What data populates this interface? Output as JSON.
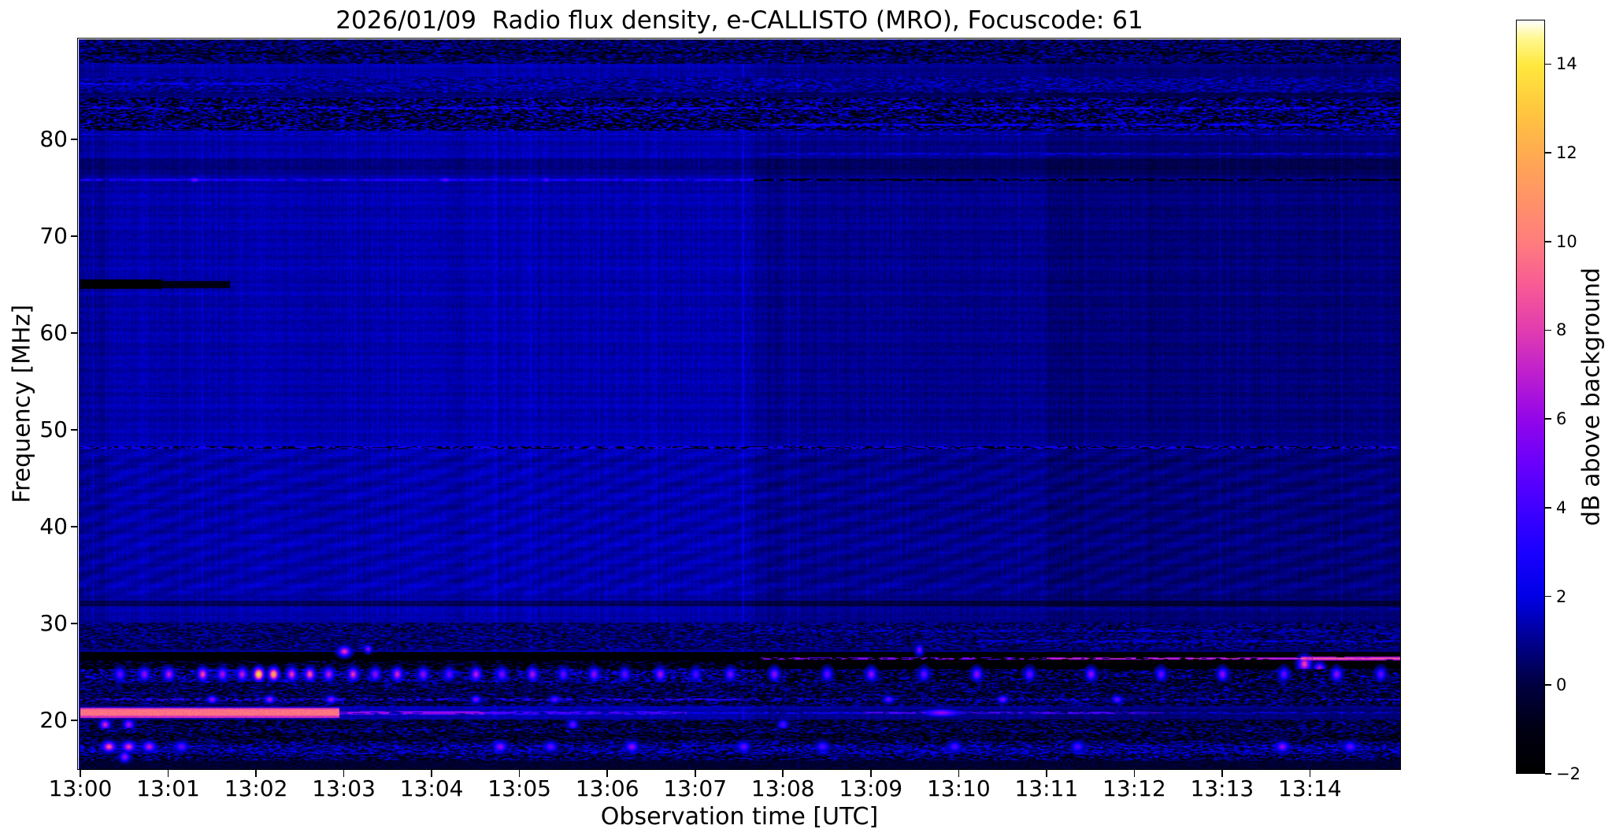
{
  "title": "2026/01/09  Radio flux density, e-CALLISTO (MRO), Focuscode: 61",
  "axes": {
    "x_label": "Observation time [UTC]",
    "y_label": "Frequency [MHz]",
    "x_ticks": [
      "13:00",
      "13:01",
      "13:02",
      "13:03",
      "13:04",
      "13:05",
      "13:06",
      "13:07",
      "13:08",
      "13:09",
      "13:10",
      "13:11",
      "13:12",
      "13:13",
      "13:14"
    ],
    "y_ticks": [
      80,
      70,
      60,
      50,
      40,
      30,
      20
    ],
    "colorbar_label": "dB above background",
    "colorbar_ticks": [
      {
        "v": 14,
        "label": "14"
      },
      {
        "v": 12,
        "label": "12"
      },
      {
        "v": 10,
        "label": "10"
      },
      {
        "v": 8,
        "label": "8"
      },
      {
        "v": 6,
        "label": "6"
      },
      {
        "v": 4,
        "label": "4"
      },
      {
        "v": 2,
        "label": "2"
      },
      {
        "v": 0,
        "label": "0"
      },
      {
        "v": -2,
        "label": "−2"
      }
    ]
  },
  "chart_data": {
    "type": "heatmap",
    "title": "2026/01/09  Radio flux density, e-CALLISTO (MRO), Focuscode: 61",
    "xlabel": "Observation time [UTC]",
    "ylabel": "Frequency [MHz]",
    "date": "2026/01/09",
    "instrument": "e-CALLISTO (MRO)",
    "focuscode": "61",
    "x_start": "13:00",
    "x_duration_minutes": 15.05,
    "y_range_mhz": [
      14.98,
      90.32
    ],
    "value_range_db": [
      -2,
      15
    ],
    "colormap_stops": [
      {
        "x": 0.0,
        "c": "#000000"
      },
      {
        "x": 0.059,
        "c": "#000014"
      },
      {
        "x": 0.118,
        "c": "#000041"
      },
      {
        "x": 0.176,
        "c": "#00008f"
      },
      {
        "x": 0.235,
        "c": "#0000e6"
      },
      {
        "x": 0.294,
        "c": "#1a00ff"
      },
      {
        "x": 0.353,
        "c": "#4000ff"
      },
      {
        "x": 0.412,
        "c": "#6a00fc"
      },
      {
        "x": 0.471,
        "c": "#9406e8"
      },
      {
        "x": 0.529,
        "c": "#bc1ecf"
      },
      {
        "x": 0.588,
        "c": "#e13cb0"
      },
      {
        "x": 0.647,
        "c": "#f75a95"
      },
      {
        "x": 0.706,
        "c": "#ff7d7d"
      },
      {
        "x": 0.765,
        "c": "#ff9466"
      },
      {
        "x": 0.824,
        "c": "#ffab50"
      },
      {
        "x": 0.882,
        "c": "#ffc73e"
      },
      {
        "x": 0.941,
        "c": "#ffe83e"
      },
      {
        "x": 0.976,
        "c": "#fff78f"
      },
      {
        "x": 1.0,
        "c": "#ffffff"
      }
    ],
    "background_regions": [
      {
        "t1": 0,
        "t2": 0.32,
        "level": 1.05
      },
      {
        "t1": 0.32,
        "t2": 7.67,
        "level": 1.35
      },
      {
        "t1": 7.67,
        "t2": 11.0,
        "level": 0.95
      },
      {
        "t1": 11.0,
        "t2": 15.05,
        "level": 0.7
      }
    ],
    "fringe_band_mhz": [
      33.0,
      48.0
    ],
    "features": [
      {
        "kind": "speckle",
        "f1": 87.9,
        "f2": 90.3,
        "t1": 0,
        "t2": 15.05,
        "p": 0.45,
        "bright": [
          0.6,
          1.8
        ],
        "dark": [
          -1.3,
          0.1
        ]
      },
      {
        "kind": "dash",
        "f": 88.9,
        "hw": 1,
        "t1": 0,
        "t2": 15.05,
        "amp": -1.6,
        "duty": 0.5,
        "dash": [
          3,
          9
        ]
      },
      {
        "kind": "speckle",
        "f1": 84.9,
        "f2": 86.4,
        "t1": 0,
        "t2": 15.05,
        "p": 0.5,
        "bright": [
          1.0,
          2.2
        ],
        "dark": [
          0.0,
          0.8
        ]
      },
      {
        "kind": "dash",
        "f": 85.8,
        "hw": 1,
        "t1": 0,
        "t2": 2.3,
        "amp": 2.6,
        "duty": 0.75,
        "dash": [
          4,
          14
        ]
      },
      {
        "kind": "speckle",
        "f1": 81.0,
        "f2": 84.3,
        "t1": 0,
        "t2": 15.05,
        "p": 0.42,
        "bright": [
          0.8,
          2.6
        ],
        "dark": [
          -1.9,
          -0.3
        ]
      },
      {
        "kind": "dash",
        "f": 83.25,
        "hw": 1,
        "t1": 0,
        "t2": 15.05,
        "amp": 2.9,
        "duty": 0.55,
        "dash": [
          3,
          10
        ]
      },
      {
        "kind": "dash",
        "f": 81.55,
        "hw": 1,
        "t1": 7.67,
        "t2": 15.05,
        "amp": 2.7,
        "duty": 0.7,
        "dash": [
          4,
          12
        ]
      },
      {
        "kind": "dash",
        "f": 80.55,
        "hw": 1,
        "t1": 0,
        "t2": 15.05,
        "amp": 2.2,
        "duty": 0.45,
        "dash": [
          3,
          9
        ]
      },
      {
        "kind": "dash",
        "f": 78.55,
        "hw": 1,
        "t1": 7.67,
        "t2": 15.05,
        "amp": 2.3,
        "duty": 0.55,
        "dash": [
          3,
          10
        ]
      },
      {
        "kind": "add",
        "f1": 76.4,
        "f2": 78.0,
        "t1": 0,
        "t2": 15.05,
        "amp": -0.5
      },
      {
        "kind": "add",
        "f1": 84.3,
        "f2": 84.9,
        "t1": 0,
        "t2": 15.05,
        "amp": -0.45
      },
      {
        "kind": "dash",
        "f": 75.85,
        "hw": 1,
        "t1": 0,
        "t2": 7.67,
        "amp": 3.4,
        "duty": 0.8,
        "dash": [
          4,
          12
        ]
      },
      {
        "kind": "blob",
        "t": 1.3,
        "f": 75.85,
        "amp": 5.5,
        "rx": 5,
        "ry": 2
      },
      {
        "kind": "blob",
        "t": 4.15,
        "f": 75.85,
        "amp": 5.0,
        "rx": 6,
        "ry": 2
      },
      {
        "kind": "blob",
        "t": 5.3,
        "f": 75.85,
        "amp": 4.6,
        "rx": 4,
        "ry": 2
      },
      {
        "kind": "dash",
        "f": 75.85,
        "hw": 1,
        "t1": 7.67,
        "t2": 15.05,
        "amp": -1.8,
        "duty": 0.85,
        "dash": [
          4,
          12
        ]
      },
      {
        "kind": "dash",
        "f": 75.85,
        "hw": 1,
        "t1": 7.67,
        "t2": 15.05,
        "amp": 2.6,
        "duty": 0.1,
        "dash": [
          2,
          5
        ]
      },
      {
        "kind": "set",
        "f1": 64.6,
        "f2": 65.5,
        "t1": 0,
        "t2": 0.93,
        "amp": -1.95,
        "noise": 0.1
      },
      {
        "kind": "set",
        "f1": 64.75,
        "f2": 65.35,
        "t1": 0.93,
        "t2": 1.7,
        "amp": -1.1,
        "noise": 0.3
      },
      {
        "kind": "dash2",
        "f": 48.2,
        "hw": 1,
        "t1": 0,
        "t2": 15.05,
        "bright": 2.7,
        "dark": -1.9,
        "dash": [
          2,
          7
        ]
      },
      {
        "kind": "add",
        "f1": 48.45,
        "f2": 48.8,
        "t1": 0,
        "t2": 15.05,
        "amp": 0.3
      },
      {
        "kind": "add",
        "f1": 31.9,
        "f2": 32.35,
        "t1": 0,
        "t2": 15.05,
        "amp": -1.0
      },
      {
        "kind": "dash",
        "f": 31.55,
        "hw": 1,
        "t1": 10.4,
        "t2": 15.05,
        "amp": 1.5,
        "duty": 0.5,
        "dash": [
          3,
          9
        ]
      },
      {
        "kind": "speckle",
        "f1": 27.3,
        "f2": 30.1,
        "t1": 0,
        "t2": 15.05,
        "p": 0.5,
        "bright": [
          0.5,
          1.8
        ],
        "dark": [
          -1.0,
          0.3
        ]
      },
      {
        "kind": "dash",
        "f": 28.2,
        "hw": 1,
        "t1": 10.2,
        "t2": 15.05,
        "amp": 2.2,
        "duty": 0.6,
        "dash": [
          4,
          10
        ]
      },
      {
        "kind": "dash",
        "f": 29.3,
        "hw": 1,
        "t1": 7.7,
        "t2": 15.05,
        "amp": 1.8,
        "duty": 0.5,
        "dash": [
          4,
          10
        ]
      },
      {
        "kind": "set",
        "f1": 25.3,
        "f2": 27.1,
        "t1": 0,
        "t2": 15.05,
        "amp": -1.85,
        "noise": 0.25
      },
      {
        "kind": "speckle",
        "f1": 25.4,
        "f2": 26.2,
        "t1": 0,
        "t2": 7.7,
        "p": 0.22,
        "bright": [
          0.2,
          1.4
        ],
        "dark": [
          -1.9,
          -1.3
        ]
      },
      {
        "kind": "blob",
        "t": 3.0,
        "f": 27.15,
        "amp": 8,
        "rx": 5,
        "ry": 4
      },
      {
        "kind": "blob",
        "t": 3.27,
        "f": 27.4,
        "amp": 6,
        "rx": 3,
        "ry": 3
      },
      {
        "kind": "blob",
        "t": 9.55,
        "f": 27.3,
        "amp": 5.5,
        "rx": 3,
        "ry": 4
      },
      {
        "kind": "dash",
        "f": 26.4,
        "hw": 1,
        "t1": 7.75,
        "t2": 11.0,
        "amp": 6.3,
        "duty": 0.5,
        "dash": [
          3,
          8
        ]
      },
      {
        "kind": "dash",
        "f": 26.4,
        "hw": 1,
        "t1": 11.0,
        "t2": 15.05,
        "amp": 7.8,
        "duty": 0.85,
        "dash": [
          4,
          10
        ]
      },
      {
        "kind": "dash",
        "f": 26.45,
        "hw": 2,
        "t1": 13.9,
        "t2": 15.05,
        "amp": 9.3,
        "duty": 0.95,
        "dash": [
          5,
          12
        ]
      },
      {
        "kind": "blob",
        "t": 13.93,
        "f": 25.9,
        "amp": 8.2,
        "rx": 5,
        "ry": 6
      },
      {
        "kind": "blob",
        "t": 14.1,
        "f": 25.5,
        "amp": 6.5,
        "rx": 4,
        "ry": 4
      },
      {
        "kind": "speckle",
        "f1": 23.9,
        "f2": 25.3,
        "t1": 0,
        "t2": 7.7,
        "p": 0.55,
        "bright": [
          0.5,
          2.8
        ],
        "dark": [
          -1.8,
          -0.4
        ]
      },
      {
        "kind": "speckle",
        "f1": 23.9,
        "f2": 25.3,
        "t1": 7.7,
        "t2": 15.05,
        "p": 0.4,
        "bright": [
          0.3,
          2.2
        ],
        "dark": [
          -2.0,
          -0.8
        ]
      },
      {
        "kind": "blobrow",
        "f": 24.85,
        "rx": 4,
        "ry": 5,
        "pts": [
          [
            0.45,
            5
          ],
          [
            0.73,
            6
          ],
          [
            1.0,
            7
          ],
          [
            1.39,
            8.5
          ],
          [
            1.61,
            6.5
          ],
          [
            1.84,
            7
          ],
          [
            2.03,
            14
          ],
          [
            2.2,
            12
          ],
          [
            2.4,
            8
          ],
          [
            2.61,
            9
          ],
          [
            2.82,
            7
          ],
          [
            3.1,
            8
          ],
          [
            3.35,
            6
          ],
          [
            3.6,
            7.5
          ],
          [
            3.9,
            6
          ],
          [
            4.2,
            5
          ],
          [
            4.5,
            7
          ],
          [
            4.8,
            5.5
          ],
          [
            5.15,
            6.5
          ],
          [
            5.5,
            5
          ],
          [
            5.85,
            6
          ],
          [
            6.2,
            5
          ],
          [
            6.6,
            6.5
          ],
          [
            7.0,
            4.5
          ],
          [
            7.4,
            5.5
          ],
          [
            7.9,
            6
          ],
          [
            8.5,
            5
          ],
          [
            9.0,
            6
          ],
          [
            9.6,
            5
          ],
          [
            10.2,
            6
          ],
          [
            10.8,
            5
          ],
          [
            11.5,
            6
          ],
          [
            12.3,
            5
          ],
          [
            13.0,
            6
          ],
          [
            13.7,
            5
          ],
          [
            14.3,
            6
          ],
          [
            14.8,
            5
          ]
        ]
      },
      {
        "kind": "speckle",
        "f1": 21.6,
        "f2": 23.9,
        "t1": 0,
        "t2": 15.05,
        "p": 0.45,
        "bright": [
          0.3,
          1.8
        ],
        "dark": [
          -1.6,
          -0.2
        ]
      },
      {
        "kind": "dash",
        "f": 22.2,
        "hw": 1,
        "t1": 0,
        "t2": 7.7,
        "amp": 3.8,
        "duty": 0.45,
        "dash": [
          3,
          8
        ]
      },
      {
        "kind": "dash",
        "f": 22.2,
        "hw": 1,
        "t1": 7.7,
        "t2": 15.05,
        "amp": 3.0,
        "duty": 0.3,
        "dash": [
          2,
          6
        ]
      },
      {
        "kind": "blobrow",
        "f": 22.2,
        "rx": 4,
        "ry": 3,
        "pts": [
          [
            1.5,
            6
          ],
          [
            2.15,
            6.5
          ],
          [
            2.85,
            6
          ],
          [
            4.5,
            5.5
          ],
          [
            5.4,
            5
          ],
          [
            9.2,
            5
          ],
          [
            10.5,
            5.5
          ],
          [
            11.8,
            5
          ]
        ]
      },
      {
        "kind": "set",
        "f1": 20.35,
        "f2": 21.35,
        "t1": 0,
        "t2": 2.95,
        "amp": 7.6,
        "noise": 0.5
      },
      {
        "kind": "add",
        "f1": 20.55,
        "f2": 21.15,
        "t1": 0,
        "t2": 2.95,
        "amp": 2.1
      },
      {
        "kind": "dash",
        "f": 20.85,
        "hw": 2,
        "t1": 2.95,
        "t2": 4.6,
        "amp": 6.6,
        "duty": 0.8,
        "dash": [
          5,
          14
        ]
      },
      {
        "kind": "dash",
        "f": 20.85,
        "hw": 2,
        "t1": 4.6,
        "t2": 6.9,
        "amp": 4.6,
        "duty": 0.7,
        "dash": [
          4,
          12
        ]
      },
      {
        "kind": "dash",
        "f": 20.85,
        "hw": 1,
        "t1": 6.9,
        "t2": 8.9,
        "amp": 2.8,
        "duty": 0.6,
        "dash": [
          4,
          10
        ]
      },
      {
        "kind": "dash",
        "f": 20.85,
        "hw": 1,
        "t1": 8.9,
        "t2": 12.3,
        "amp": 4.8,
        "duty": 0.55,
        "dash": [
          4,
          10
        ]
      },
      {
        "kind": "blob",
        "t": 9.8,
        "f": 20.85,
        "amp": 6,
        "rx": 14,
        "ry": 3
      },
      {
        "kind": "dash",
        "f": 20.85,
        "hw": 1,
        "t1": 12.3,
        "t2": 15.05,
        "amp": 2.2,
        "duty": 0.5,
        "dash": [
          3,
          9
        ]
      },
      {
        "kind": "speckle",
        "f1": 19.2,
        "f2": 20.1,
        "t1": 0,
        "t2": 15.05,
        "p": 0.4,
        "bright": [
          0.2,
          1.6
        ],
        "dark": [
          -1.8,
          -0.5
        ]
      },
      {
        "kind": "blobrow",
        "f": 19.6,
        "rx": 4,
        "ry": 4,
        "pts": [
          [
            0.28,
            7.5
          ],
          [
            0.55,
            6.5
          ],
          [
            5.6,
            5
          ],
          [
            8.0,
            4.5
          ]
        ]
      },
      {
        "kind": "speckle",
        "f1": 15.3,
        "f2": 19.2,
        "t1": 0,
        "t2": 15.05,
        "p": 0.5,
        "bright": [
          0.2,
          2.0
        ],
        "dark": [
          -1.9,
          -0.4
        ]
      },
      {
        "kind": "add",
        "f1": 18.0,
        "f2": 18.7,
        "t1": 0,
        "t2": 15.05,
        "amp": -0.6
      },
      {
        "kind": "speckle",
        "f1": 16.6,
        "f2": 17.5,
        "t1": 0,
        "t2": 15.05,
        "p": 0.6,
        "bright": [
          0.8,
          2.6
        ],
        "dark": [
          -1.2,
          0.2
        ]
      },
      {
        "kind": "set",
        "f1": 14.98,
        "f2": 15.9,
        "t1": 0,
        "t2": 15.05,
        "amp": -0.4,
        "noise": 0.9
      },
      {
        "kind": "blobrow",
        "f": 17.3,
        "rx": 5,
        "ry": 4,
        "pts": [
          [
            0.32,
            9
          ],
          [
            0.55,
            8
          ],
          [
            0.78,
            7
          ],
          [
            1.15,
            5
          ],
          [
            4.78,
            6
          ],
          [
            5.35,
            5
          ],
          [
            6.28,
            6
          ],
          [
            7.55,
            5
          ],
          [
            8.45,
            4.5
          ],
          [
            9.95,
            4.5
          ],
          [
            11.35,
            4.5
          ],
          [
            13.68,
            6
          ],
          [
            14.45,
            5
          ]
        ]
      },
      {
        "kind": "blob",
        "t": 0.5,
        "f": 16.3,
        "amp": 6,
        "rx": 4,
        "ry": 4
      },
      {
        "kind": "vline",
        "t": 4.73,
        "w": 5,
        "amp": 0.55,
        "f1": 15,
        "f2": 88
      },
      {
        "kind": "vline",
        "t": 5.13,
        "w": 4,
        "amp": 0.5,
        "f1": 15,
        "f2": 88
      },
      {
        "kind": "vline",
        "t": 8.17,
        "w": 3,
        "amp": 0.7,
        "f1": 15,
        "f2": 88
      },
      {
        "kind": "vline",
        "t": 3.62,
        "w": 4,
        "amp": 0.3,
        "f1": 28,
        "f2": 88
      },
      {
        "kind": "vline",
        "t": 5.9,
        "w": 3,
        "amp": 0.3,
        "f1": 28,
        "f2": 88
      },
      {
        "kind": "vline",
        "t": 6.55,
        "w": 3,
        "amp": 0.3,
        "f1": 28,
        "f2": 88
      },
      {
        "kind": "vline",
        "t": 12.1,
        "w": 3,
        "amp": 0.35,
        "f1": 15,
        "f2": 88
      }
    ]
  }
}
